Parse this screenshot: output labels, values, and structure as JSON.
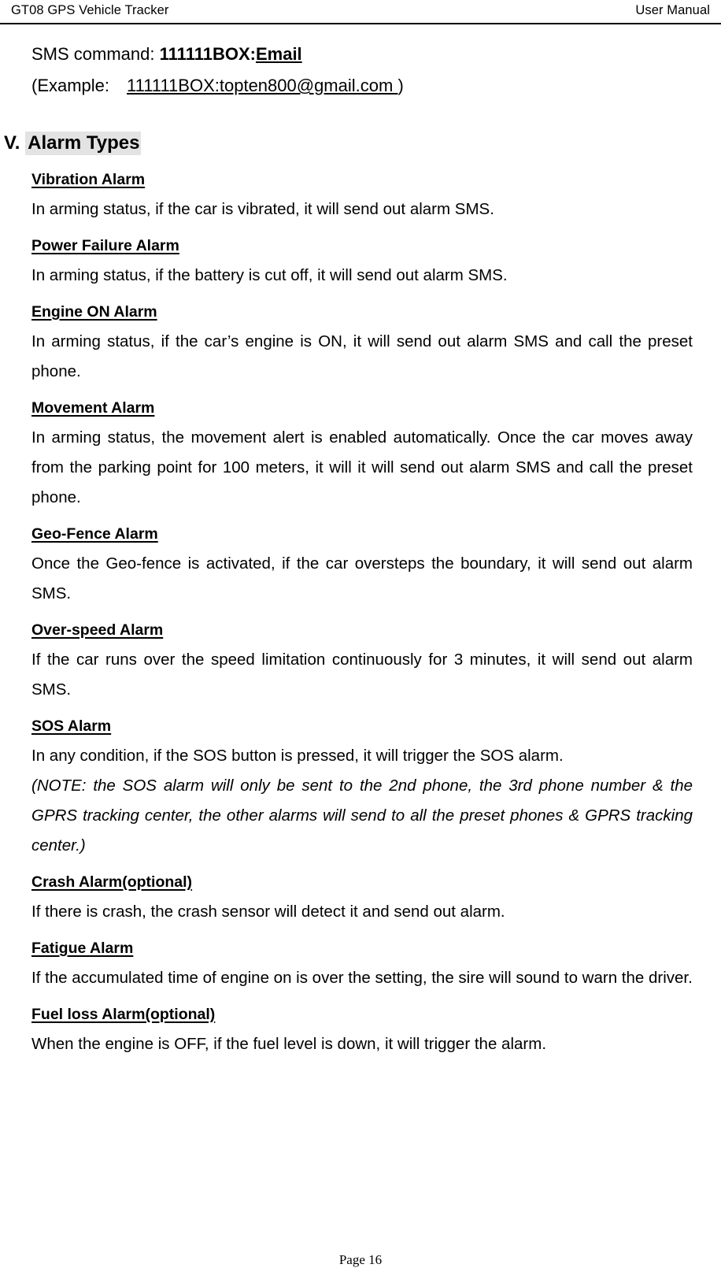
{
  "header": {
    "left": "GT08 GPS Vehicle Tracker",
    "right": "User Manual"
  },
  "intro": {
    "sms_label": "SMS command:",
    "sms_command_prefix": "111111BOX:",
    "sms_command_param": "Email",
    "example_label": "(Example:",
    "example_value": "111111BOX:topten800@gmail.com ",
    "example_close": ")"
  },
  "section": {
    "number": "V.",
    "title": "Alarm Types",
    "highlight_color": "#e3e3e3"
  },
  "alarms": [
    {
      "heading": "Vibration Alarm",
      "body": "In arming status, if the car is vibrated, it will send out alarm SMS."
    },
    {
      "heading": "Power Failure Alarm",
      "body": "In arming status, if the battery is cut off, it will send out alarm SMS."
    },
    {
      "heading": "Engine ON Alarm",
      "body": "In arming status, if the car’s engine is ON, it will send out alarm SMS and call the preset phone."
    },
    {
      "heading": "Movement Alarm",
      "body": "In arming status, the movement alert is enabled automatically. Once the car moves away from the parking point for 100 meters, it will it will send out alarm SMS and call the preset phone."
    },
    {
      "heading": "Geo-Fence Alarm",
      "body": "Once the Geo-fence is activated, if the car oversteps the boundary, it will send out alarm SMS."
    },
    {
      "heading": "Over-speed Alarm",
      "body": "If the car runs over the speed limitation continuously for 3 minutes, it will send out alarm SMS."
    },
    {
      "heading": "SOS Alarm",
      "body": "In any condition, if the SOS button is pressed, it will trigger the SOS alarm.",
      "note": "(NOTE: the SOS alarm will only be sent to the 2nd phone, the 3rd phone number & the GPRS tracking center, the other alarms will send to all the preset phones & GPRS tracking center.)"
    },
    {
      "heading": "Crash Alarm(optional)",
      "body": "If there is crash, the crash sensor will detect it and send out alarm."
    },
    {
      "heading": "Fatigue Alarm",
      "body": "If the accumulated time of engine on is over the setting, the sire will sound to warn the driver."
    },
    {
      "heading": "Fuel loss Alarm(optional)",
      "body": "When the engine is OFF, if the fuel level is down, it will trigger the alarm."
    }
  ],
  "footer": {
    "page_label": "Page 16"
  }
}
